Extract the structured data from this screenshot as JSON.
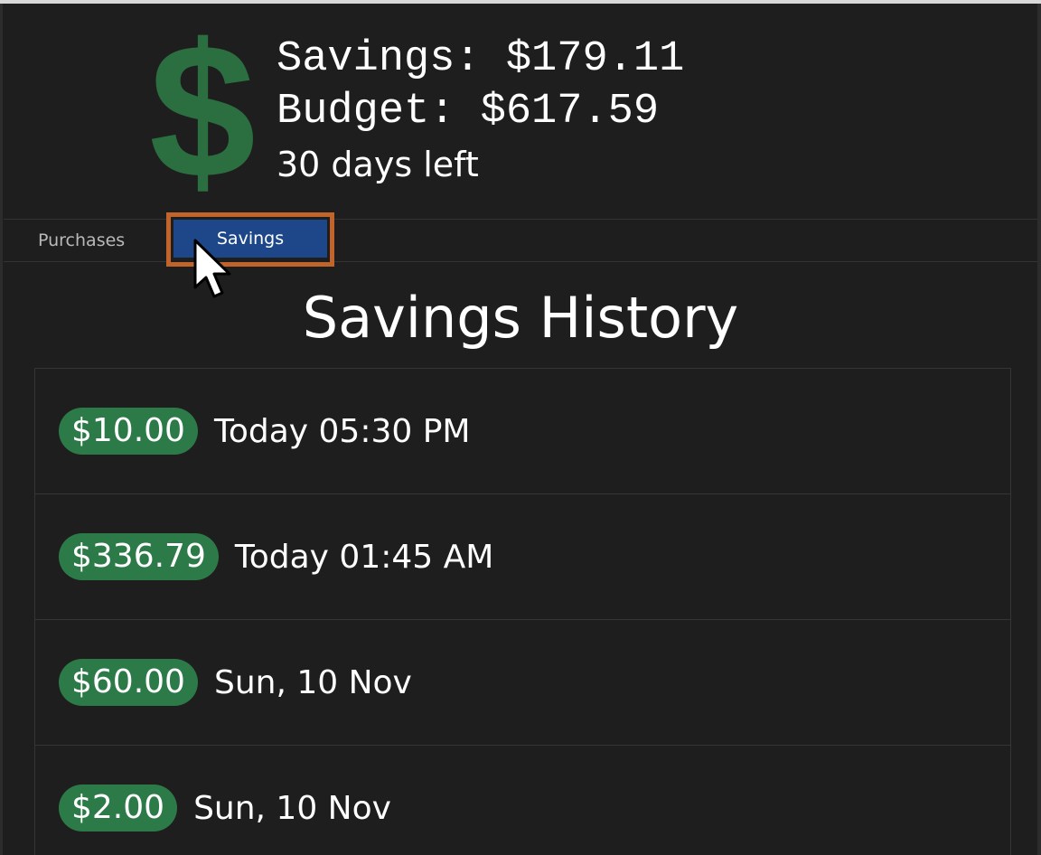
{
  "header": {
    "savings_text": "Savings: $179.11",
    "budget_text": "Budget: $617.59",
    "days_left_text": "30 days left",
    "icon": "dollar-sign-icon",
    "icon_glyph": "$",
    "icon_color": "#2b6e3f"
  },
  "tabs": {
    "purchases_label": "Purchases",
    "savings_label": "Savings",
    "active": "Savings",
    "active_color": "#1e478a",
    "highlight_color": "#c0642b"
  },
  "history": {
    "title": "Savings History",
    "badge_color": "#2d7a49",
    "items": [
      {
        "amount": "$10.00",
        "date": "Today 05:30 PM"
      },
      {
        "amount": "$336.79",
        "date": "Today 01:45 AM"
      },
      {
        "amount": "$60.00",
        "date": "Sun, 10 Nov"
      },
      {
        "amount": "$2.00",
        "date": "Sun, 10 Nov"
      }
    ]
  }
}
